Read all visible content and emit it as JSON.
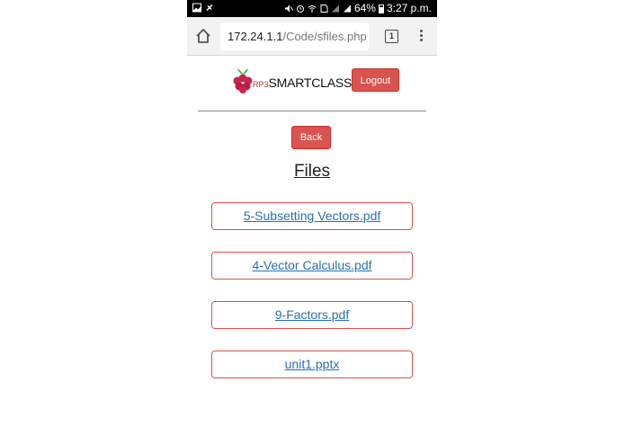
{
  "status_bar": {
    "battery_percent": "64%",
    "time": "3:27 p.m."
  },
  "browser": {
    "url_host": "172.24.1.1",
    "url_path": "/Code/sfiles.php",
    "tab_count": "1"
  },
  "header": {
    "brand_prefix": "RP3",
    "brand_name": "SMARTCLASS",
    "logout_label": "Logout"
  },
  "main": {
    "back_label": "Back",
    "title": "Files",
    "files": [
      {
        "name": "5-Subsetting Vectors.pdf"
      },
      {
        "name": "4-Vector Calculus.pdf"
      },
      {
        "name": "9-Factors.pdf"
      },
      {
        "name": "unit1.pptx"
      }
    ]
  },
  "colors": {
    "button_red": "#d9534f",
    "link_blue": "#2a6fb0",
    "raspberry": "#c7254e",
    "leaf_green": "#4caf50"
  }
}
